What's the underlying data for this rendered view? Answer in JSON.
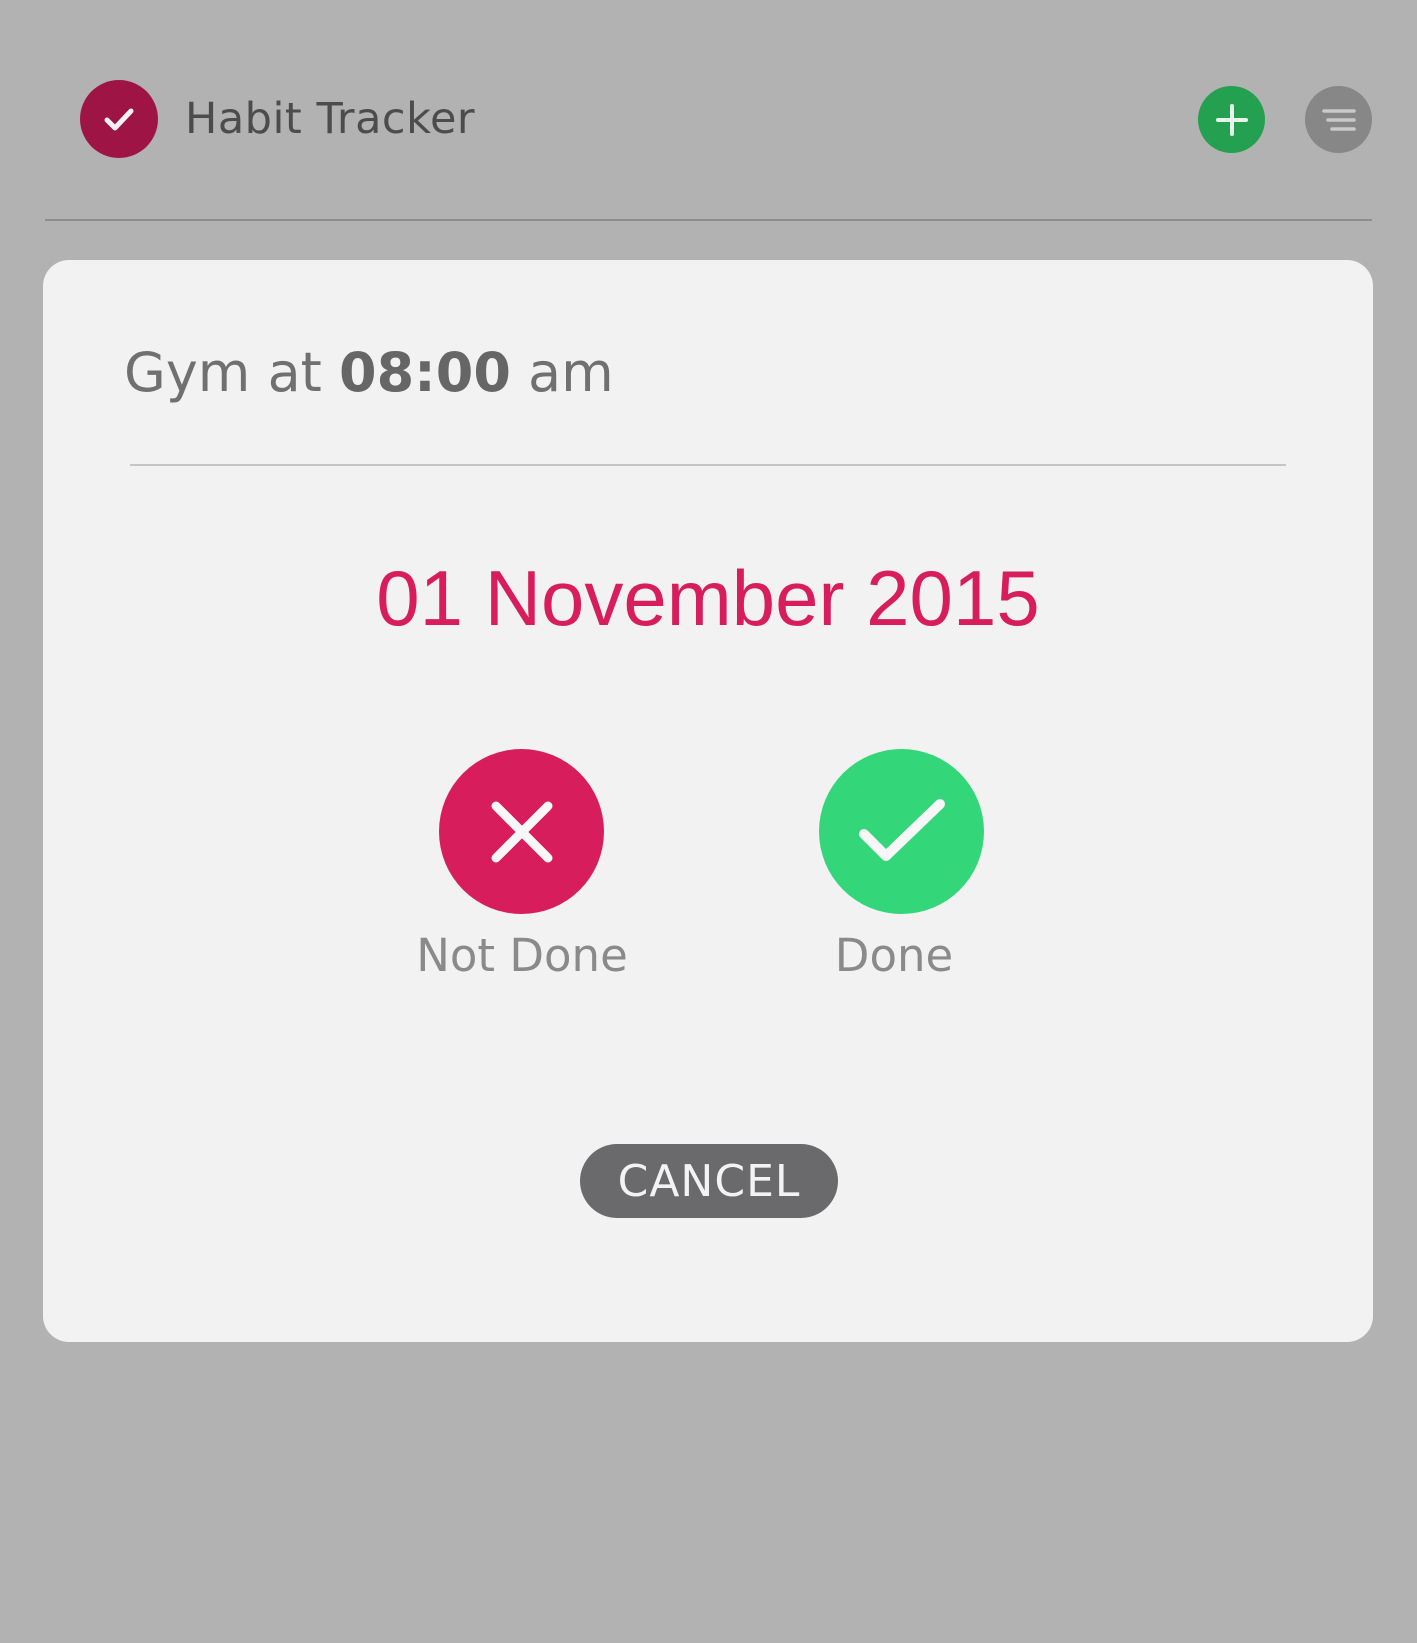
{
  "app": {
    "title": "Habit Tracker",
    "logo_icon": "check-icon",
    "add_icon": "plus-icon",
    "menu_icon": "menu-icon"
  },
  "dialog": {
    "habit_name": "Gym",
    "connector": " at ",
    "time": "08:00",
    "period": " am",
    "date": "01 November 2015",
    "actions": [
      {
        "label": "Not Done",
        "icon": "close-icon",
        "color": "#d81d5c"
      },
      {
        "label": "Done",
        "icon": "check-icon",
        "color": "#33d679"
      }
    ],
    "cancel_label": "CANCEL"
  },
  "colors": {
    "backdrop": "#b2b2b2",
    "logo": "#9e1545",
    "add_button": "#24a150",
    "menu_button": "#878787",
    "accent": "#d81d5c"
  }
}
